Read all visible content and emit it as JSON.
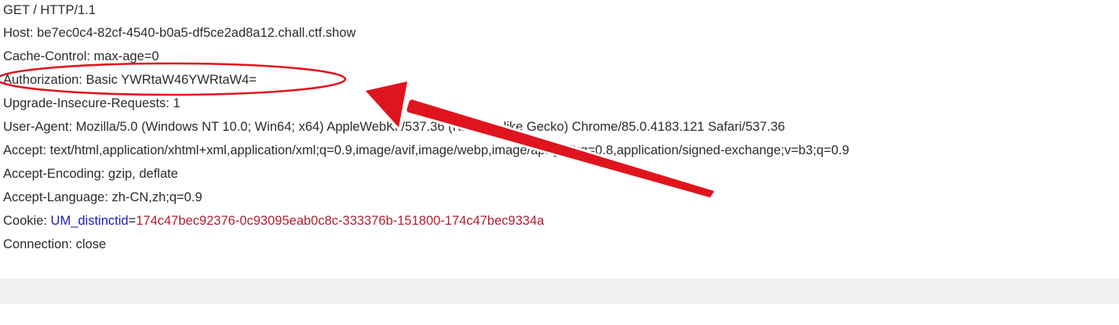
{
  "request": {
    "request_line": "GET / HTTP/1.1",
    "host": "Host: be7ec0c4-82cf-4540-b0a5-df5ce2ad8a12.chall.ctf.show",
    "cache_control": "Cache-Control: max-age=0",
    "authorization": "Authorization: Basic YWRtaW46YWRtaW4=",
    "upgrade_insecure": "Upgrade-Insecure-Requests: 1",
    "user_agent": "User-Agent: Mozilla/5.0 (Windows NT 10.0; Win64; x64) AppleWebKit/537.36 (KHTML, like Gecko) Chrome/85.0.4183.121 Safari/537.36",
    "accept": "Accept: text/html,application/xhtml+xml,application/xml;q=0.9,image/avif,image/webp,image/apng,*/*;q=0.8,application/signed-exchange;v=b3;q=0.9",
    "accept_encoding": "Accept-Encoding: gzip, deflate",
    "accept_language": "Accept-Language: zh-CN,zh;q=0.9",
    "cookie_label": "Cookie: ",
    "cookie_name": "UM_distinctid",
    "cookie_equals": "=",
    "cookie_value": "174c47bec92376-0c93095eab0c8c-333376b-151800-174c47bec9334a",
    "connection": "Connection: close"
  },
  "colors": {
    "text": "#2b2b2b",
    "cookie_name": "#1a1ab8",
    "cookie_value": "#b21f2d",
    "annotation": "#e0141e",
    "bottom_bar": "#f0f0f0"
  }
}
